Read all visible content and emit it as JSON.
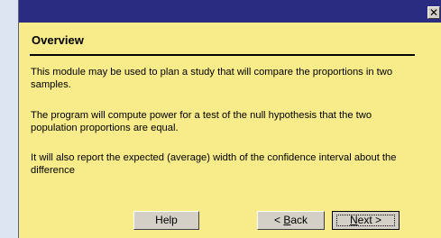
{
  "dialog": {
    "close_glyph": "✕",
    "heading": "Overview",
    "paragraphs": [
      "This module may be used to plan a study that will compare the proportions in two samples.",
      "The program will compute power for a test of the null hypothesis that the two population proportions are equal.",
      "It will also report the expected (average) width of the confidence interval about the difference"
    ]
  },
  "buttons": {
    "help": "Help",
    "back_prefix": "< ",
    "back_mnemonic": "B",
    "back_rest": "ack",
    "next_mnemonic": "N",
    "next_rest": "ext >"
  }
}
